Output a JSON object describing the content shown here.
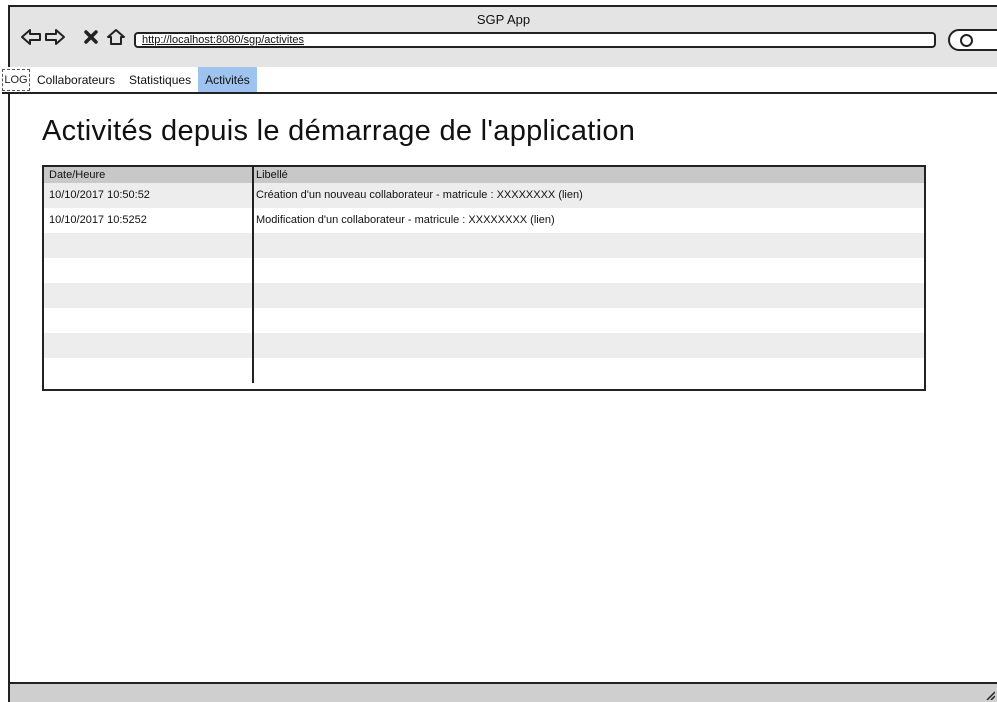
{
  "window": {
    "title": "SGP App",
    "url": "http://localhost:8080/sgp/activites"
  },
  "nav": {
    "logo": "LOG",
    "items": [
      {
        "label": "Collaborateurs"
      },
      {
        "label": "Statistiques"
      },
      {
        "label": "Activités",
        "active": true
      }
    ]
  },
  "page": {
    "title": "Activités depuis le démarrage de l'application"
  },
  "table": {
    "headers": [
      "Date/Heure",
      "Libellé"
    ],
    "rows": [
      [
        "10/10/2017 10:50:52",
        "Création d'un nouveau collaborateur - matricule : XXXXXXXX (lien)"
      ],
      [
        "10/10/2017 10:5252",
        "Modification d'un collaborateur - matricule : XXXXXXXX (lien)"
      ],
      [
        "",
        ""
      ],
      [
        "",
        ""
      ],
      [
        "",
        ""
      ],
      [
        "",
        ""
      ],
      [
        "",
        ""
      ],
      [
        "",
        ""
      ]
    ]
  },
  "icons": {
    "back": "back-arrow-icon",
    "forward": "forward-arrow-icon",
    "stop": "close-icon",
    "home": "home-icon",
    "search": "search-icon"
  },
  "colors": {
    "active_tab": "#9ec3ef",
    "header_bg": "#c8c8c8",
    "alt_row": "#ededed"
  }
}
